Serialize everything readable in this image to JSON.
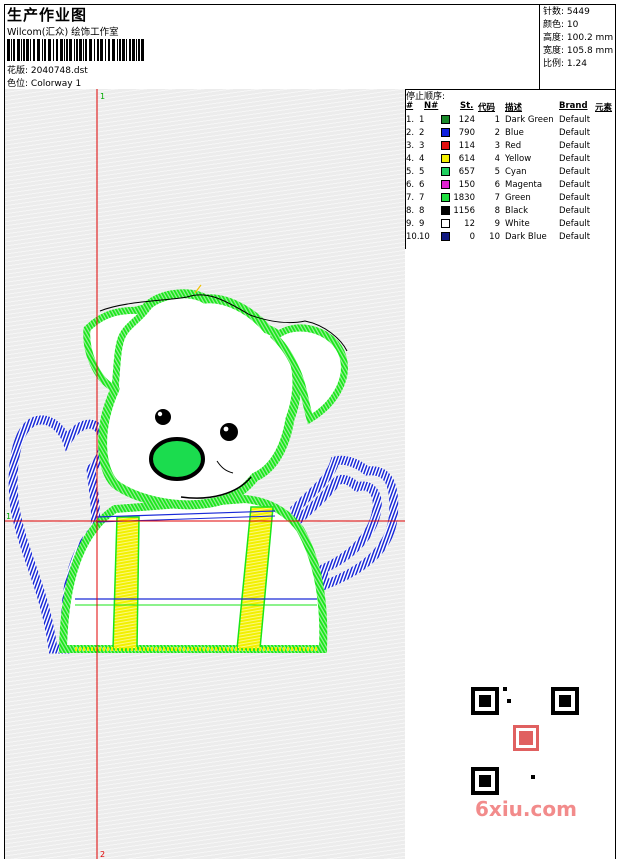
{
  "header": {
    "title": "生产作业图",
    "studio": "Wilcom(汇众) 绘饰工作室",
    "design_label": "花版:",
    "design_value": "2040748.dst",
    "colorway_label": "色位:",
    "colorway_value": "Colorway 1"
  },
  "stats": {
    "stitches_label": "针数:",
    "stitches_value": "5449",
    "colors_label": "颜色:",
    "colors_value": "10",
    "height_label": "高度:",
    "height_value": "100.2 mm",
    "width_label": "宽度:",
    "width_value": "105.8 mm",
    "scale_label": "比例:",
    "scale_value": "1.24"
  },
  "stop_sequence": {
    "title": "停止顺序:",
    "headers": {
      "hash": "#",
      "num": "N#",
      "st": "St.",
      "code": "代码",
      "desc": "描述",
      "brand": "Brand",
      "element": "元素"
    },
    "rows": [
      {
        "idx": "1.",
        "n": "1",
        "color": "#1a8a2a",
        "st": "124",
        "code": "1",
        "desc": "Dark Green",
        "brand": "Default"
      },
      {
        "idx": "2.",
        "n": "2",
        "color": "#1020e0",
        "st": "790",
        "code": "2",
        "desc": "Blue",
        "brand": "Default"
      },
      {
        "idx": "3.",
        "n": "3",
        "color": "#e01010",
        "st": "114",
        "code": "3",
        "desc": "Red",
        "brand": "Default"
      },
      {
        "idx": "4.",
        "n": "4",
        "color": "#f4f000",
        "st": "614",
        "code": "4",
        "desc": "Yellow",
        "brand": "Default"
      },
      {
        "idx": "5.",
        "n": "5",
        "color": "#20d060",
        "st": "657",
        "code": "5",
        "desc": "Cyan",
        "brand": "Default"
      },
      {
        "idx": "6.",
        "n": "6",
        "color": "#e020d0",
        "st": "150",
        "code": "6",
        "desc": "Magenta",
        "brand": "Default"
      },
      {
        "idx": "7.",
        "n": "7",
        "color": "#20e040",
        "st": "1830",
        "code": "7",
        "desc": "Green",
        "brand": "Default"
      },
      {
        "idx": "8.",
        "n": "8",
        "color": "#000000",
        "st": "1156",
        "code": "8",
        "desc": "Black",
        "brand": "Default"
      },
      {
        "idx": "9.",
        "n": "9",
        "color": "#ffffff",
        "st": "12",
        "code": "9",
        "desc": "White",
        "brand": "Default"
      },
      {
        "idx": "10.",
        "n": "10",
        "color": "#101880",
        "st": "0",
        "code": "10",
        "desc": "Dark Blue",
        "brand": "Default"
      }
    ]
  },
  "axis_markers": {
    "top": "1",
    "bottom": "2",
    "left": "1"
  },
  "watermark": "6xiu.com",
  "colors": {
    "guide": "#e00000",
    "outline_green": "#19e619",
    "blue": "#1a2ad8",
    "yellow": "#f2f000"
  }
}
